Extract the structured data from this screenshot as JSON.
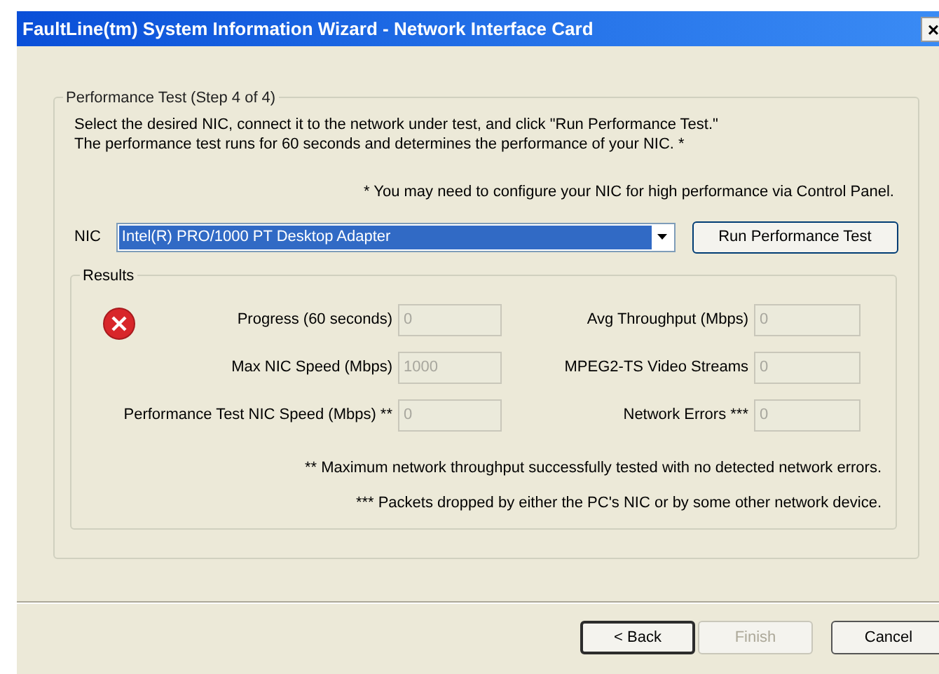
{
  "window": {
    "title": "FaultLine(tm) System Information Wizard - Network Interface Card",
    "close": "×"
  },
  "group": {
    "title": "Performance Test  (Step 4 of 4)",
    "instructions": [
      "Select the desired NIC, connect it to the network under test, and click \"Run Performance Test.\"",
      "The performance test runs for 60 seconds and determines the performance of your NIC. *"
    ],
    "note": "*  You may need to configure your NIC for high performance via Control Panel.",
    "nic_label": "NIC",
    "nic_value": "Intel(R) PRO/1000 PT Desktop Adapter",
    "run_button": "Run Performance Test"
  },
  "results": {
    "title": "Results",
    "fields": [
      {
        "label": "Progress (60 seconds)",
        "value": "0",
        "disabled": true
      },
      {
        "label": "Avg Throughput (Mbps)",
        "value": "0",
        "disabled": true
      },
      {
        "label": "Max NIC Speed (Mbps)",
        "value": "1000",
        "disabled": true
      },
      {
        "label": "MPEG2-TS Video Streams",
        "value": "0",
        "disabled": true
      },
      {
        "label": "Performance Test NIC Speed (Mbps) **",
        "value": "0",
        "disabled": true
      },
      {
        "label": "Network Errors ***",
        "value": "0",
        "disabled": true
      }
    ],
    "footnotes": [
      "**  Maximum network throughput successfully tested with no detected network errors.",
      "***  Packets dropped by either the PC's NIC or by some other network device."
    ]
  },
  "buttons": [
    {
      "label": "< Back",
      "disabled": false,
      "default": true
    },
    {
      "label": "Finish",
      "disabled": true,
      "default": false
    },
    {
      "label": "Cancel",
      "disabled": false,
      "default": false
    }
  ]
}
